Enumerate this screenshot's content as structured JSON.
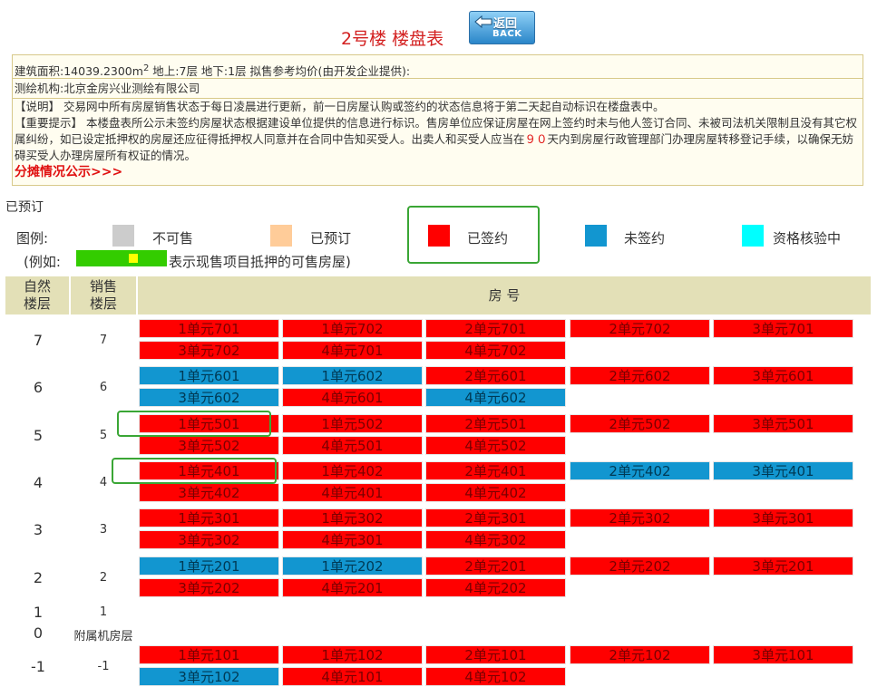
{
  "page": {
    "title": "2号楼  楼盘表",
    "back_button": {
      "cn": "返回",
      "en": "BACK",
      "icon": "back-arrow-icon"
    }
  },
  "info": {
    "area_line": "建筑面积:14039.2300m",
    "area_sup": "2",
    "area_rest": " 地上:7层  地下:1层  拟售参考均价(由开发企业提供):",
    "survey": "测绘机构:北京金房兴业测绘有限公司",
    "note": "【说明】 交易网中所有房屋销售状态于每日凌晨进行更新，前一日房屋认购或签约的状态信息将于第二天起自动标识在楼盘表中。",
    "tip_part1": "【重要提示】 本楼盘表所公示未签约房屋状态根据建设单位提供的信息进行标识。售房单位应保证房屋在网上签约时未与他人签订合同、未被司法机关限制且没有其它权属纠纷，如已设定抵押权的房屋还应征得抵押权人同意并在合同中告知买受人。出卖人和买受人应当在",
    "tip_days": "９０",
    "tip_part2": "天内到房屋行政管理部门办理房屋转移登记手续，以确保无妨碍买受人办理房屋所有权证的情况。",
    "share_link": "分摊情况公示>>>"
  },
  "status_line": "已预订",
  "legend": {
    "prefix": "图例:",
    "items": [
      {
        "label": "不可售",
        "color": "#cccccc"
      },
      {
        "label": "已预订",
        "color": "#ffcc99"
      },
      {
        "label": "已签约",
        "color": "#ff0000"
      },
      {
        "label": "未签约",
        "color": "#1296d0"
      },
      {
        "label": "资格核验中",
        "color": "#00ffff"
      }
    ],
    "example_prefix": "(例如:",
    "example_suffix": "表示现售项目抵押的可售房屋)"
  },
  "table": {
    "headers": {
      "natural_floor": "自然\n楼层",
      "sale_floor": "销售\n楼层",
      "room": "房 号"
    },
    "floors": [
      {
        "natural": "7",
        "sale": "7",
        "units": [
          {
            "label": "1单元701",
            "status": "signed"
          },
          {
            "label": "1单元702",
            "status": "signed"
          },
          {
            "label": "2单元701",
            "status": "signed"
          },
          {
            "label": "2单元702",
            "status": "signed"
          },
          {
            "label": "3单元701",
            "status": "signed"
          },
          {
            "label": "3单元702",
            "status": "signed"
          },
          {
            "label": "4单元701",
            "status": "signed"
          },
          {
            "label": "4单元702",
            "status": "signed"
          }
        ]
      },
      {
        "natural": "6",
        "sale": "6",
        "units": [
          {
            "label": "1单元601",
            "status": "unsigned"
          },
          {
            "label": "1单元602",
            "status": "unsigned"
          },
          {
            "label": "2单元601",
            "status": "signed"
          },
          {
            "label": "2单元602",
            "status": "signed"
          },
          {
            "label": "3单元601",
            "status": "signed"
          },
          {
            "label": "3单元602",
            "status": "unsigned"
          },
          {
            "label": "4单元601",
            "status": "signed"
          },
          {
            "label": "4单元602",
            "status": "unsigned"
          }
        ]
      },
      {
        "natural": "5",
        "sale": "5",
        "units": [
          {
            "label": "1单元501",
            "status": "signed"
          },
          {
            "label": "1单元502",
            "status": "signed"
          },
          {
            "label": "2单元501",
            "status": "signed"
          },
          {
            "label": "2单元502",
            "status": "signed"
          },
          {
            "label": "3单元501",
            "status": "signed"
          },
          {
            "label": "3单元502",
            "status": "signed"
          },
          {
            "label": "4单元501",
            "status": "signed"
          },
          {
            "label": "4单元502",
            "status": "signed"
          }
        ]
      },
      {
        "natural": "4",
        "sale": "4",
        "units": [
          {
            "label": "1单元401",
            "status": "signed"
          },
          {
            "label": "1单元402",
            "status": "signed"
          },
          {
            "label": "2单元401",
            "status": "signed"
          },
          {
            "label": "2单元402",
            "status": "unsigned"
          },
          {
            "label": "3单元401",
            "status": "unsigned"
          },
          {
            "label": "3单元402",
            "status": "signed"
          },
          {
            "label": "4单元401",
            "status": "signed"
          },
          {
            "label": "4单元402",
            "status": "signed"
          }
        ]
      },
      {
        "natural": "3",
        "sale": "3",
        "units": [
          {
            "label": "1单元301",
            "status": "signed"
          },
          {
            "label": "1单元302",
            "status": "signed"
          },
          {
            "label": "2单元301",
            "status": "signed"
          },
          {
            "label": "2单元302",
            "status": "signed"
          },
          {
            "label": "3单元301",
            "status": "signed"
          },
          {
            "label": "3单元302",
            "status": "signed"
          },
          {
            "label": "4单元301",
            "status": "signed"
          },
          {
            "label": "4单元302",
            "status": "signed"
          }
        ]
      },
      {
        "natural": "2",
        "sale": "2",
        "units": [
          {
            "label": "1单元201",
            "status": "unsigned"
          },
          {
            "label": "1单元202",
            "status": "unsigned"
          },
          {
            "label": "2单元201",
            "status": "signed"
          },
          {
            "label": "2单元202",
            "status": "signed"
          },
          {
            "label": "3单元201",
            "status": "signed"
          },
          {
            "label": "3单元202",
            "status": "signed"
          },
          {
            "label": "4单元201",
            "status": "signed"
          },
          {
            "label": "4单元202",
            "status": "signed"
          }
        ]
      },
      {
        "natural": "1",
        "sale": "1",
        "units": []
      },
      {
        "natural": "0",
        "sale": "附属机房层",
        "units": []
      },
      {
        "natural": "-1",
        "sale": "-1",
        "units": [
          {
            "label": "1单元101",
            "status": "signed"
          },
          {
            "label": "1单元102",
            "status": "signed"
          },
          {
            "label": "2单元101",
            "status": "signed"
          },
          {
            "label": "2单元102",
            "status": "signed"
          },
          {
            "label": "3单元101",
            "status": "signed"
          },
          {
            "label": "3单元102",
            "status": "unsigned"
          },
          {
            "label": "4单元101",
            "status": "signed"
          },
          {
            "label": "4单元102",
            "status": "signed"
          }
        ]
      }
    ]
  }
}
